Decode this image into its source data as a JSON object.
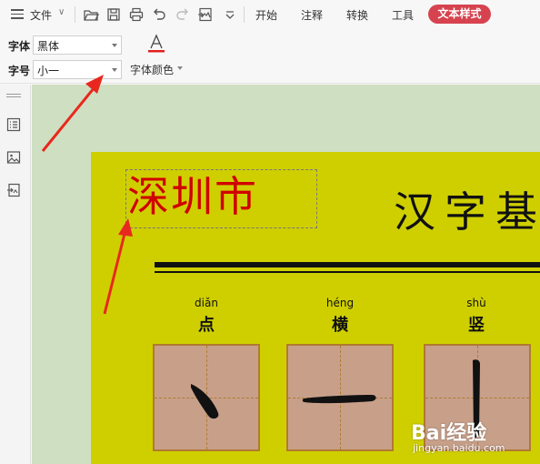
{
  "menubar": {
    "file": "文件",
    "tabs": [
      "开始",
      "注释",
      "转换",
      "工具"
    ],
    "active_tab": "文本样式",
    "accent_color": "#d6434f"
  },
  "ribbon": {
    "font_label": "字体",
    "font_value": "黑体",
    "size_label": "字号",
    "size_value": "小一",
    "font_color_label": "字体颜色",
    "font_color_accent": "#e02020"
  },
  "page": {
    "selected_text": "深圳市",
    "selected_text_color": "#d00000",
    "title": "汉字基",
    "strokes": [
      {
        "pinyin": "diǎn",
        "hanzi": "点",
        "stroke": "dot"
      },
      {
        "pinyin": "héng",
        "hanzi": "横",
        "stroke": "horizontal"
      },
      {
        "pinyin": "shù",
        "hanzi": "竖",
        "stroke": "vertical"
      }
    ],
    "page_color": "#cfcf00",
    "canvas_color": "#cfdfc2"
  },
  "watermark": {
    "logo": "Bai经验",
    "url": "jingyan.baidu.com"
  }
}
